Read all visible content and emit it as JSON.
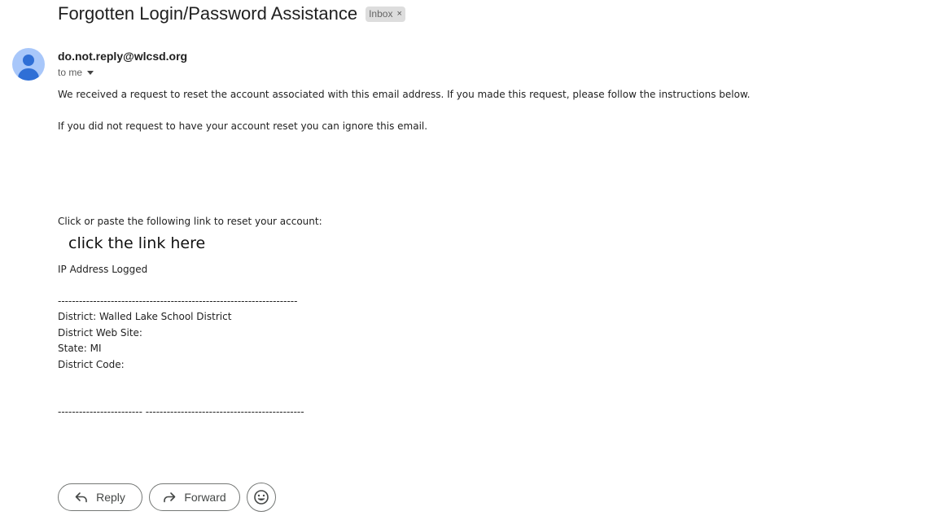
{
  "email": {
    "subject": "Forgotten Login/Password Assistance",
    "label": "Inbox",
    "label_remove": "×",
    "sender": "do.not.reply@wlcsd.org",
    "recipient": "to me",
    "paragraph_1": "We received a request to reset the account associated with this email address.  If you made this request, please follow the instructions below.",
    "paragraph_2": "If you did not request to have your account reset you can ignore this email.",
    "link_intro": "Click or paste the following link to reset your account:",
    "link_text": "click the link here",
    "ip_line": "IP Address Logged",
    "divider_1": "--------------------------------------------------------------------",
    "district": "District: Walled Lake School District",
    "web_site": "District Web Site:",
    "state": "State: MI",
    "district_code": "District Code:",
    "divider_2": "------------------------ ---------------------------------------------"
  },
  "actions": {
    "reply": "Reply",
    "forward": "Forward"
  },
  "icons": {
    "avatar": "person-avatar-icon",
    "reply": "reply-arrow-icon",
    "forward": "forward-arrow-icon",
    "emoji": "emoji-smiley-icon",
    "dropdown": "chevron-down-icon"
  },
  "colors": {
    "avatar_bg": "#a8c7fa",
    "avatar_fg": "#2f6fd6",
    "chip_bg": "#dddddd"
  }
}
